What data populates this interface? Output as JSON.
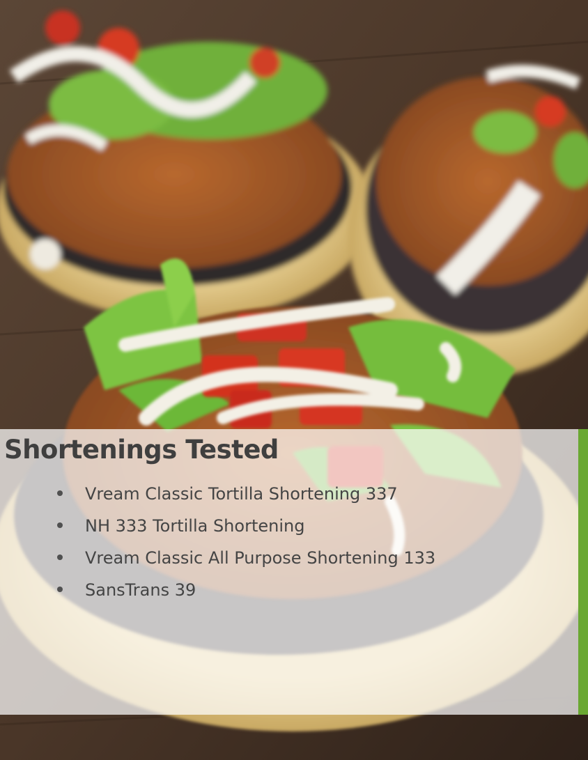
{
  "slide": {
    "heading": "Shortenings Tested",
    "items": [
      {
        "label": "Vream Classic Tortilla Shortening 337"
      },
      {
        "label": "NH 333 Tortilla Shortening"
      },
      {
        "label": "Vream Classic All Purpose Shortening 133"
      },
      {
        "label": "SansTrans 39"
      }
    ]
  },
  "colors": {
    "accent": "#6aa832",
    "heading_text": "#3f3f3f",
    "body_text": "#444444",
    "overlay": "rgba(255,255,255,0.72)"
  }
}
